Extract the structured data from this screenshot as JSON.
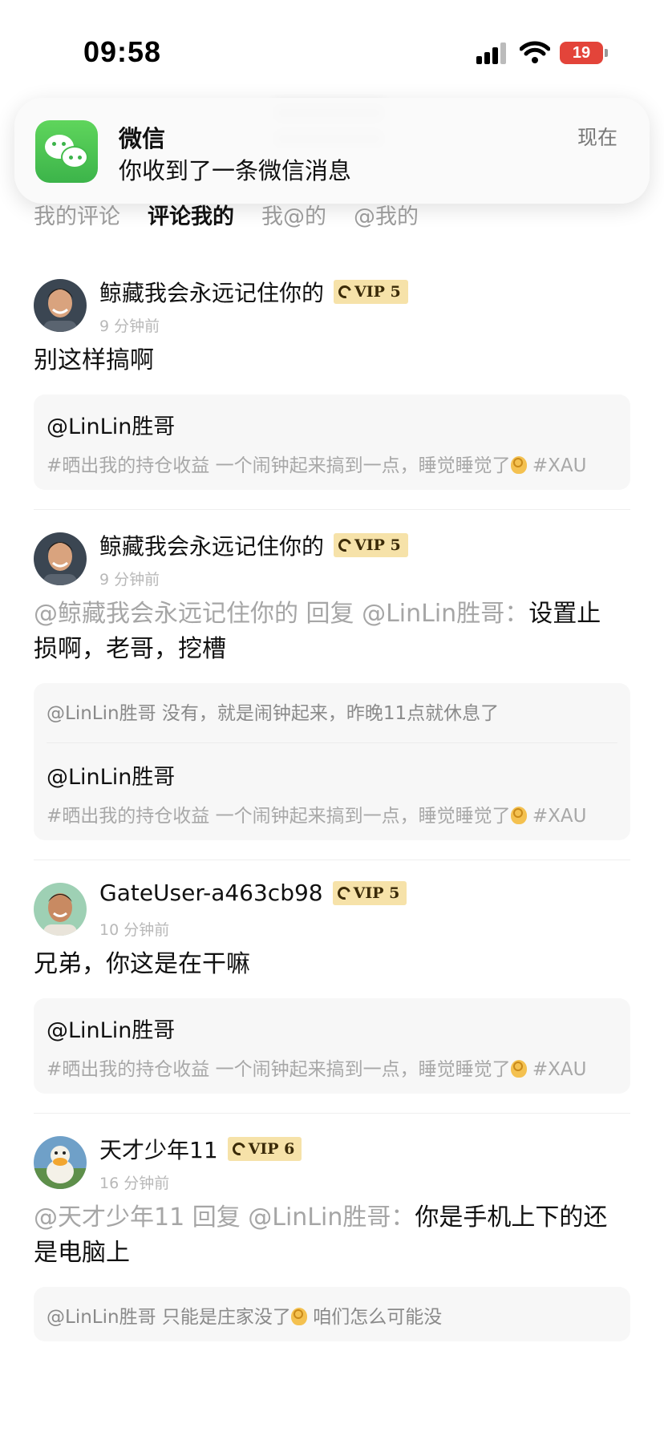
{
  "status_bar": {
    "time": "09:58",
    "battery": "19",
    "signal_icon": "signal-bars-icon",
    "wifi_icon": "wifi-icon"
  },
  "notification": {
    "app": "微信",
    "message": "你收到了一条微信消息",
    "time": "现在",
    "icon": "wechat-icon"
  },
  "tabs": [
    "我的评论",
    "评论我的",
    "我@的",
    "@我的"
  ],
  "active_tab": "评论我的",
  "vip_color": "#f6e2a9",
  "items": [
    {
      "username": "鲸藏我会永远记住你的",
      "vip": "VIP 5",
      "time": "9 分钟前",
      "content_grey": "",
      "content": "别这样搞啊",
      "quote_reply": "",
      "quote_user": "@LinLin胜哥",
      "quote_text": "#晒出我的持仓收益 一个闹钟起来搞到一点，睡觉睡觉了",
      "quote_tag": "#XAU"
    },
    {
      "username": "鲸藏我会永远记住你的",
      "vip": "VIP 5",
      "time": "9 分钟前",
      "content_grey": "@鲸藏我会永远记住你的 回复 @LinLin胜哥：",
      "content": "设置止损啊，老哥，挖槽",
      "quote_reply": "@LinLin胜哥 没有，就是闹钟起来，昨晚11点就休息了",
      "quote_user": "@LinLin胜哥",
      "quote_text": "#晒出我的持仓收益 一个闹钟起来搞到一点，睡觉睡觉了",
      "quote_tag": "#XAU"
    },
    {
      "username": "GateUser-a463cb98",
      "vip": "VIP 5",
      "time": "10 分钟前",
      "content_grey": "",
      "content": "兄弟，你这是在干嘛",
      "quote_reply": "",
      "quote_user": "@LinLin胜哥",
      "quote_text": "#晒出我的持仓收益 一个闹钟起来搞到一点，睡觉睡觉了",
      "quote_tag": "#XAU"
    },
    {
      "username": "天才少年11",
      "vip": "VIP 6",
      "time": "16 分钟前",
      "content_grey": "@天才少年11 回复 @LinLin胜哥：",
      "content": "你是手机上下的还是电脑上",
      "quote_reply": "",
      "quote_user": "",
      "quote_text": "@LinLin胜哥 只能是庄家没了",
      "quote_tag": "咱们怎么可能没"
    }
  ]
}
